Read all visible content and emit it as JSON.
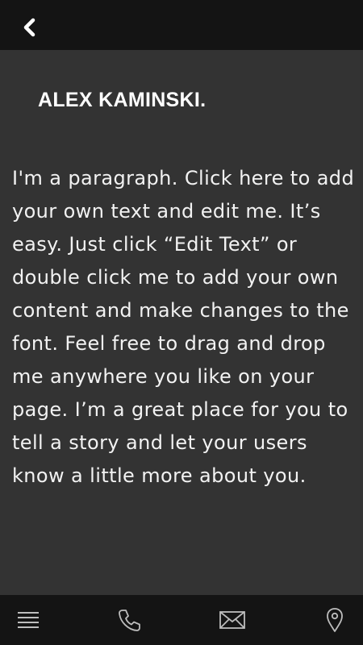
{
  "header": {
    "back_icon": "chevron-left-icon"
  },
  "main": {
    "title": "ALEX KAMINSKI.",
    "paragraph": "I'm a paragraph. Click here to add your own text and edit me. It’s easy. Just click “Edit Text” or double click me to add your own content and make changes to the font. Feel free to drag and drop me anywhere you like on your page. I’m a great place for you to tell a story and let your users know a little more about you."
  },
  "bottom_nav": {
    "items": [
      {
        "icon": "menu-icon"
      },
      {
        "icon": "phone-icon"
      },
      {
        "icon": "mail-icon"
      },
      {
        "icon": "location-pin-icon"
      }
    ]
  },
  "colors": {
    "bars": "#141414",
    "background": "#333333",
    "text": "#ffffff",
    "icons": "#bdbdbd"
  }
}
